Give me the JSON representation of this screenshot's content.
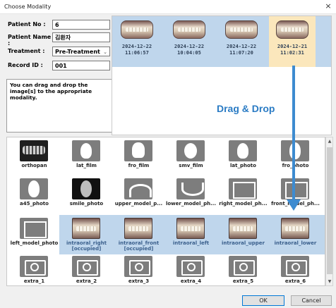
{
  "window": {
    "title": "Choose Modality",
    "close_glyph": "×"
  },
  "patient": {
    "patient_no_label": "Patient No :",
    "patient_no": "6",
    "patient_name_label": "Patient Name :",
    "patient_name": "김환자",
    "treatment_label": "Treatment :",
    "treatment": "Pre-Treatment",
    "record_id_label": "Record ID :",
    "record_id": "001"
  },
  "instructions": "You can drag and drop the image[s] to the appropriate modality.",
  "top_thumbnails": [
    {
      "date": "2024-12-22",
      "time": "11:06:57"
    },
    {
      "date": "2024-12-22",
      "time": "10:04:05"
    },
    {
      "date": "2024-12-22",
      "time": "11:07:20"
    },
    {
      "date": "2024-12-21",
      "time": "11:02:31"
    }
  ],
  "drag_drop_label": "Drag & Drop",
  "modalities": {
    "row1": [
      "orthopan",
      "lat_film",
      "fro_film",
      "smv_film",
      "lat_photo",
      "fro_photo"
    ],
    "row2": [
      "a45_photo",
      "smile_photo",
      "upper_model_p...",
      "lower_model_ph...",
      "right_model_ph...",
      "front_model_ph..."
    ],
    "row3": [
      "left_model_photo",
      "intraoral_right [occupied]",
      "intraoral_front [occupied]",
      "intraoral_left",
      "intraoral_upper",
      "intraoral_lower"
    ],
    "row4": [
      "extra_1",
      "extra_2",
      "extra_3",
      "extra_4",
      "extra_5",
      "extra_6"
    ]
  },
  "buttons": {
    "ok": "OK",
    "cancel": "Cancel"
  },
  "colors": {
    "selection_blue": "#bfd6ec",
    "selected_orange": "#fbe7bc",
    "arrow_blue": "#3d8bd0"
  }
}
